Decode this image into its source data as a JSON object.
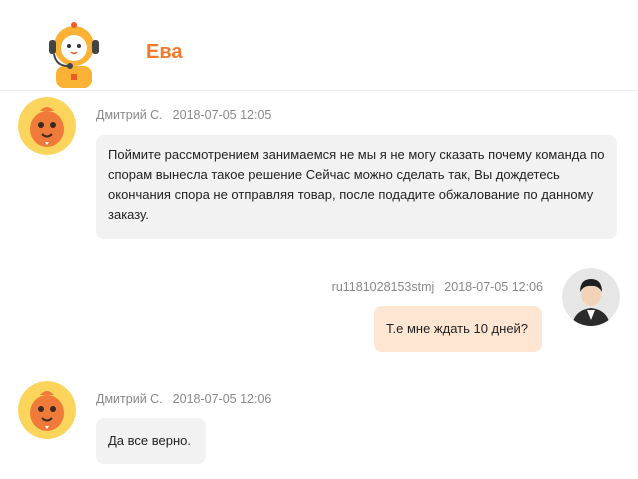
{
  "header": {
    "title": "Ева",
    "bot_avatar_icon": "robot-headset-icon",
    "accent_color": "#f5792a"
  },
  "messages": [
    {
      "direction": "incoming",
      "author": "Дмитрий С.",
      "time": "2018-07-05 12:05",
      "text": "Поймите рассмотрением занимаемся не мы я не могу сказать почему команда по спорам вынесла такое решение Сейчас можно сделать так, Вы дождетесь окончания спора не отправляя товар, после подадите обжалование по данному заказу.",
      "avatar_icon": "orange-mascot-icon"
    },
    {
      "direction": "outgoing",
      "author": "ru1181028153stmj",
      "time": "2018-07-05 12:06",
      "text": "Т.е мне ждать 10 дней?",
      "avatar_icon": "user-photo-icon"
    },
    {
      "direction": "incoming",
      "author": "Дмитрий С.",
      "time": "2018-07-05 12:06",
      "text": "Да все верно.",
      "avatar_icon": "orange-mascot-icon"
    }
  ]
}
